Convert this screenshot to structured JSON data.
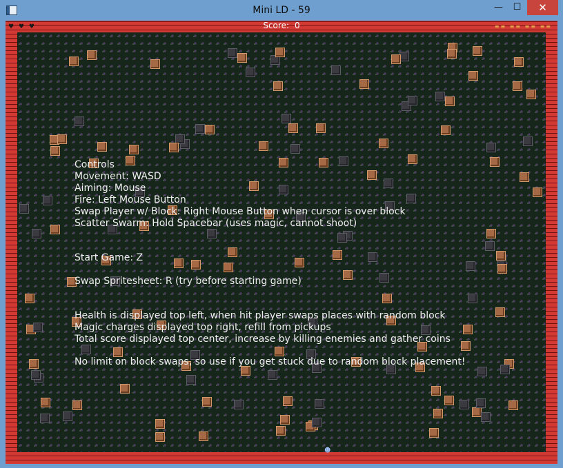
{
  "window": {
    "title": "Mini LD - 59",
    "minimize_glyph": "—",
    "maximize_glyph": "☐",
    "close_glyph": "✕"
  },
  "hud": {
    "hearts": "♥ ♥ ♥",
    "score_label": "Score:",
    "score_value": "0",
    "magic_charges": "≡≡ ≡≡ ≡≡ ≡≡"
  },
  "instructions": {
    "heading": "Controls",
    "movement": "Movement: WASD",
    "aiming": "Aiming: Mouse",
    "fire": "Fire: Left Mouse Button",
    "swap": "Swap Player w/ Block: Right Mouse Button when cursor is over block",
    "scatter": "Scatter Swarm: Hold Spacebar (uses magic, cannot shoot)",
    "start": "Start Game: Z",
    "spritesheet": "Swap Spritesheet: R (try before starting game)",
    "health": "Health is displayed top left, when hit player swaps places with random block",
    "magic": "Magic charges displayed top right, refill from pickups",
    "score": "Total score displayed top center, increase by killing enemies and gather coins",
    "nolimit": "No limit on block swaps, so use if you get stuck due to random block placement!"
  },
  "colors": {
    "wall": "#d23a33",
    "floor": "#16261a",
    "crate": "#a56a45",
    "stone": "#3a3a40",
    "text": "#eeeeee"
  },
  "player_glyph": "☻"
}
